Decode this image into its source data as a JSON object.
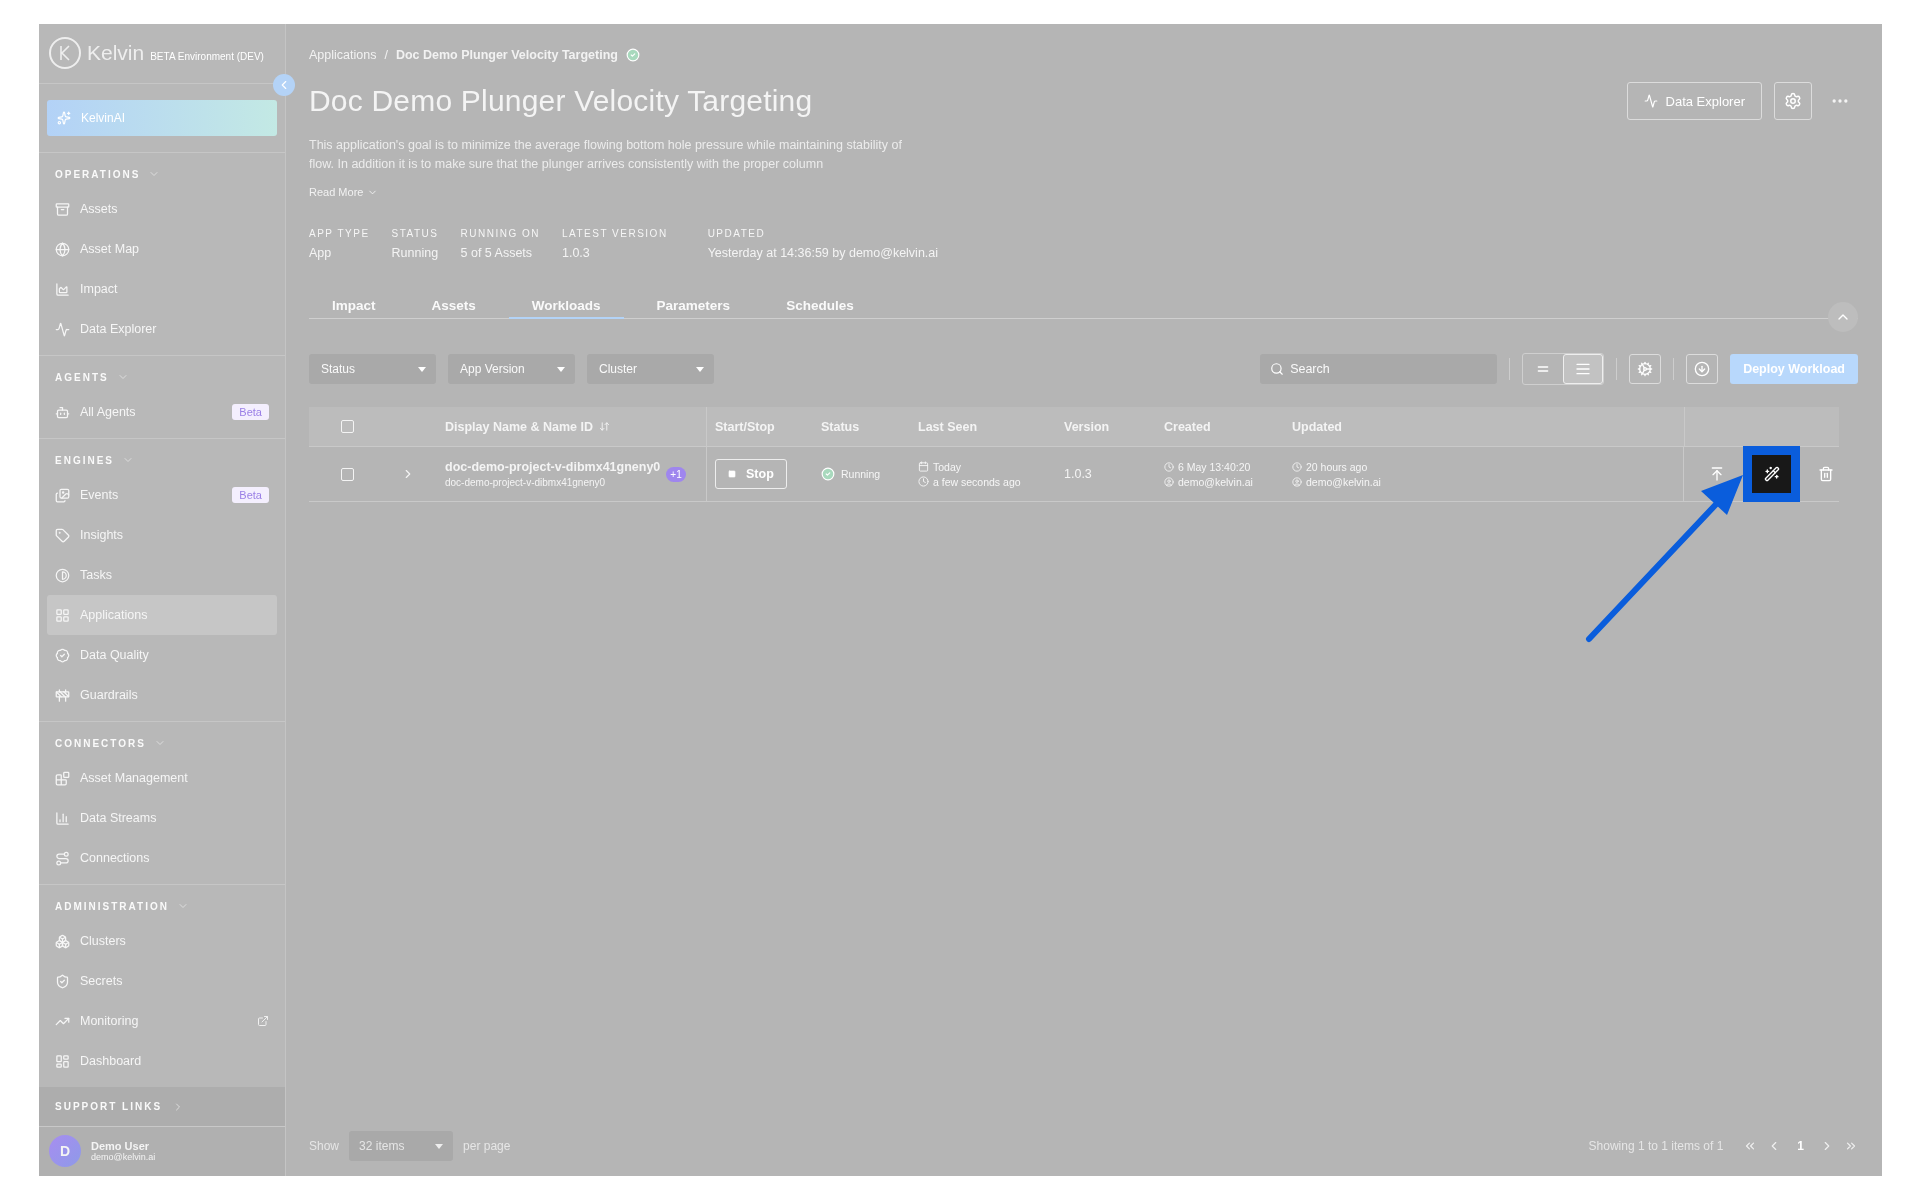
{
  "sidebar": {
    "logo": "Kelvin",
    "environment": "BETA Environment (DEV)",
    "ai_button": "KelvinAI",
    "sections": [
      {
        "title": "OPERATIONS",
        "expanded": true,
        "items": [
          {
            "label": "Assets",
            "selected": false
          },
          {
            "label": "Asset Map",
            "selected": false
          },
          {
            "label": "Impact",
            "selected": false
          },
          {
            "label": "Data Explorer",
            "selected": false
          }
        ]
      },
      {
        "title": "AGENTS",
        "expanded": true,
        "items": [
          {
            "label": "All Agents",
            "selected": false,
            "badge": "Beta"
          }
        ]
      },
      {
        "title": "ENGINES",
        "expanded": true,
        "items": [
          {
            "label": "Events",
            "selected": false,
            "badge": "Beta"
          },
          {
            "label": "Insights",
            "selected": false
          },
          {
            "label": "Tasks",
            "selected": false
          },
          {
            "label": "Applications",
            "selected": true
          },
          {
            "label": "Data Quality",
            "selected": false
          },
          {
            "label": "Guardrails",
            "selected": false
          }
        ]
      },
      {
        "title": "CONNECTORS",
        "expanded": true,
        "items": [
          {
            "label": "Asset Management",
            "selected": false
          },
          {
            "label": "Data Streams",
            "selected": false
          },
          {
            "label": "Connections",
            "selected": false
          }
        ]
      },
      {
        "title": "ADMINISTRATION",
        "expanded": true,
        "items": [
          {
            "label": "Clusters",
            "selected": false
          },
          {
            "label": "Secrets",
            "selected": false
          },
          {
            "label": "Monitoring",
            "selected": false,
            "external": true
          },
          {
            "label": "Dashboard",
            "selected": false
          }
        ]
      }
    ],
    "support_links": {
      "title": "SUPPORT LINKS",
      "expanded": false
    },
    "user": {
      "initial": "D",
      "name": "Demo User",
      "email": "demo@kelvin.ai"
    }
  },
  "breadcrumb": [
    "Applications",
    "Doc Demo Plunger Velocity Targeting"
  ],
  "breadcrumb_separator": "/",
  "title": "Doc Demo Plunger Velocity Targeting",
  "description": "This application's goal is to minimize the average flowing bottom hole pressure while maintaining stability of flow. In addition it is to make sure that the plunger arrives consistently with the proper column",
  "read_more": "Read More",
  "meta": [
    {
      "label": "APP TYPE",
      "value": "App"
    },
    {
      "label": "STATUS",
      "value": "Running"
    },
    {
      "label": "RUNNING ON",
      "value": "5 of 5 Assets"
    },
    {
      "label": "LATEST VERSION",
      "value": "1.0.3"
    },
    {
      "label": "UPDATED",
      "value": "Yesterday at 14:36:59 by demo@kelvin.ai"
    }
  ],
  "header_button": "Data Explorer",
  "tabs": [
    {
      "label": "Impact",
      "selected": false
    },
    {
      "label": "Assets",
      "selected": false
    },
    {
      "label": "Workloads",
      "selected": true
    },
    {
      "label": "Parameters",
      "selected": false
    },
    {
      "label": "Schedules",
      "selected": false
    }
  ],
  "filters": [
    {
      "placeholder": "Status"
    },
    {
      "placeholder": "App Version"
    },
    {
      "placeholder": "Cluster"
    }
  ],
  "search": {
    "placeholder": "Search"
  },
  "density": [
    {
      "selected": false
    },
    {
      "selected": true
    }
  ],
  "deploy_button": "Deploy Workload",
  "table": {
    "columns": [
      "Display Name & Name ID",
      "Start/Stop",
      "Status",
      "Last Seen",
      "Version",
      "Created",
      "Updated"
    ],
    "header_checked": false,
    "rows": [
      {
        "checked": false,
        "expanded": false,
        "name": "doc-demo-project-v-dibmx41gneny0",
        "name_id": "doc-demo-project-v-dibmx41gneny0",
        "extra": "+1",
        "action": "Stop",
        "status": "Running",
        "last_seen_date": "Today",
        "last_seen_time": "a few seconds ago",
        "version": "1.0.3",
        "created_time": "6 May 13:40:20",
        "created_by": "demo@kelvin.ai",
        "updated_time": "20 hours ago",
        "updated_by": "demo@kelvin.ai",
        "actions": [
          {
            "kind": "upload",
            "highlighted": false
          },
          {
            "kind": "wand",
            "highlighted": true
          },
          {
            "kind": "delete",
            "highlighted": false
          }
        ]
      }
    ]
  },
  "pagination": {
    "show": "Show",
    "page_size": "32 items",
    "per_page": "per page",
    "summary": "Showing 1 to 1 items of 1",
    "page": "1"
  }
}
